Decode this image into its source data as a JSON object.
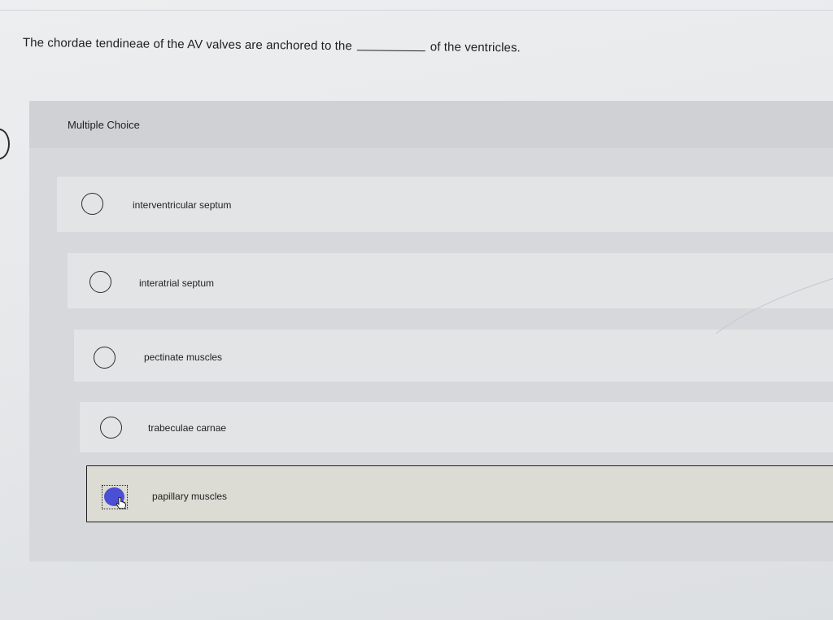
{
  "question": {
    "before_blank": "The chordae tendineae of the AV valves are anchored to the",
    "after_blank": "of the ventricles."
  },
  "panel": {
    "header": "Multiple Choice"
  },
  "options": [
    {
      "label": "interventricular septum",
      "selected": false
    },
    {
      "label": "interatrial septum",
      "selected": false
    },
    {
      "label": "pectinate muscles",
      "selected": false
    },
    {
      "label": "trabeculae carnae",
      "selected": false
    },
    {
      "label": "papillary muscles",
      "selected": true
    }
  ],
  "colors": {
    "selected_radio": "#4b4fd3",
    "panel_bg": "#d6d8db",
    "option_bg": "#e2e4e6"
  },
  "icons": {
    "cursor": "hand-pointer-icon"
  }
}
